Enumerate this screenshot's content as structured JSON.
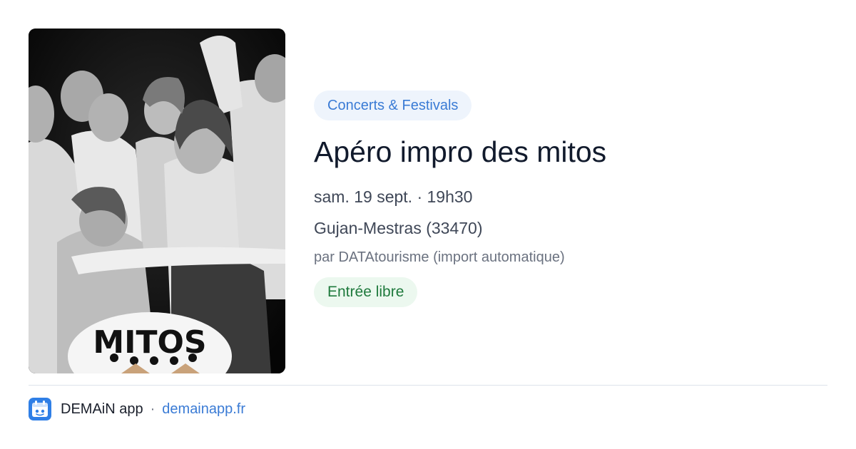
{
  "event": {
    "category": "Concerts & Festivals",
    "title": "Apéro impro des mitos",
    "datetime": "sam. 19 sept. · 19h30",
    "location": "Gujan-Mestras (33470)",
    "source": "par DATAtourisme (import automatique)",
    "price": "Entrée libre",
    "image_logo_text": "MITOS"
  },
  "footer": {
    "app_name": "DEMAiN app",
    "separator": "·",
    "domain": "demainapp.fr"
  },
  "colors": {
    "category_bg": "#eef4fc",
    "category_text": "#3a7bd5",
    "price_bg": "#ecf8ef",
    "price_text": "#1f7a3d",
    "link": "#3a7bd5",
    "title": "#111a2c"
  }
}
